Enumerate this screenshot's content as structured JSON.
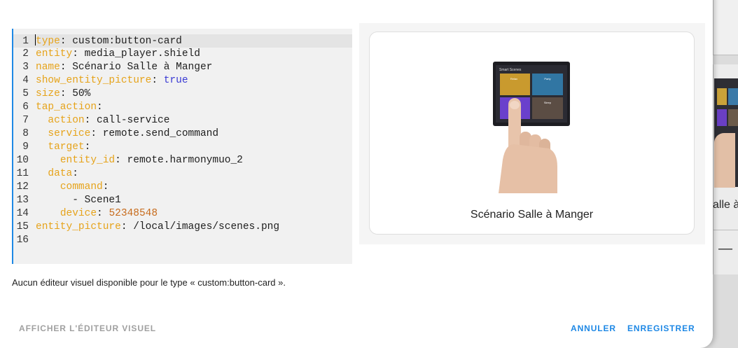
{
  "editor": {
    "lines": [
      {
        "n": "1",
        "indent": "",
        "key": "type",
        "sep": ": ",
        "value": "custom:button-card",
        "vtype": "str"
      },
      {
        "n": "2",
        "indent": "",
        "key": "entity",
        "sep": ": ",
        "value": "media_player.shield",
        "vtype": "str"
      },
      {
        "n": "3",
        "indent": "",
        "key": "name",
        "sep": ": ",
        "value": "Scénario Salle à Manger",
        "vtype": "str"
      },
      {
        "n": "4",
        "indent": "",
        "key": "show_entity_picture",
        "sep": ": ",
        "value": "true",
        "vtype": "bool"
      },
      {
        "n": "5",
        "indent": "",
        "key": "size",
        "sep": ": ",
        "value": "50%",
        "vtype": "str"
      },
      {
        "n": "6",
        "indent": "",
        "key": "tap_action",
        "sep": ":",
        "value": "",
        "vtype": "str"
      },
      {
        "n": "7",
        "indent": "  ",
        "key": "action",
        "sep": ": ",
        "value": "call-service",
        "vtype": "str"
      },
      {
        "n": "8",
        "indent": "  ",
        "key": "service",
        "sep": ": ",
        "value": "remote.send_command",
        "vtype": "str"
      },
      {
        "n": "9",
        "indent": "  ",
        "key": "target",
        "sep": ":",
        "value": "",
        "vtype": "str"
      },
      {
        "n": "10",
        "indent": "    ",
        "key": "entity_id",
        "sep": ": ",
        "value": "remote.harmonymuo_2",
        "vtype": "str"
      },
      {
        "n": "11",
        "indent": "  ",
        "key": "data",
        "sep": ":",
        "value": "",
        "vtype": "str"
      },
      {
        "n": "12",
        "indent": "    ",
        "key": "command",
        "sep": ":",
        "value": "",
        "vtype": "str"
      },
      {
        "n": "13",
        "indent": "      ",
        "key": "",
        "sep": "",
        "value": "- Scene1",
        "vtype": "str"
      },
      {
        "n": "14",
        "indent": "    ",
        "key": "device",
        "sep": ": ",
        "value": "52348548",
        "vtype": "num"
      },
      {
        "n": "15",
        "indent": "",
        "key": "entity_picture",
        "sep": ": ",
        "value": "/local/images/scenes.png",
        "vtype": "str"
      },
      {
        "n": "16",
        "indent": "",
        "key": "",
        "sep": "",
        "value": "",
        "vtype": "str"
      }
    ]
  },
  "info_text": "Aucun éditeur visuel disponible pour le type « custom:button-card ».",
  "buttons": {
    "visual_editor": "AFFICHER L'ÉDITEUR VISUEL",
    "cancel": "ANNULER",
    "save": "ENREGISTRER"
  },
  "preview": {
    "card_name": "Scénario Salle à Manger",
    "picture_header": "Smart Scenes",
    "tiles": [
      "Relax",
      "Party",
      "Movie",
      "Sleep"
    ]
  },
  "background": {
    "card_text": "alle à"
  },
  "colors": {
    "accent": "#1e88e5",
    "yaml_key": "#e6a31a",
    "yaml_bool": "#3b3bd4",
    "yaml_number": "#c76b1c",
    "disabled_button": "#a0a0a0"
  }
}
